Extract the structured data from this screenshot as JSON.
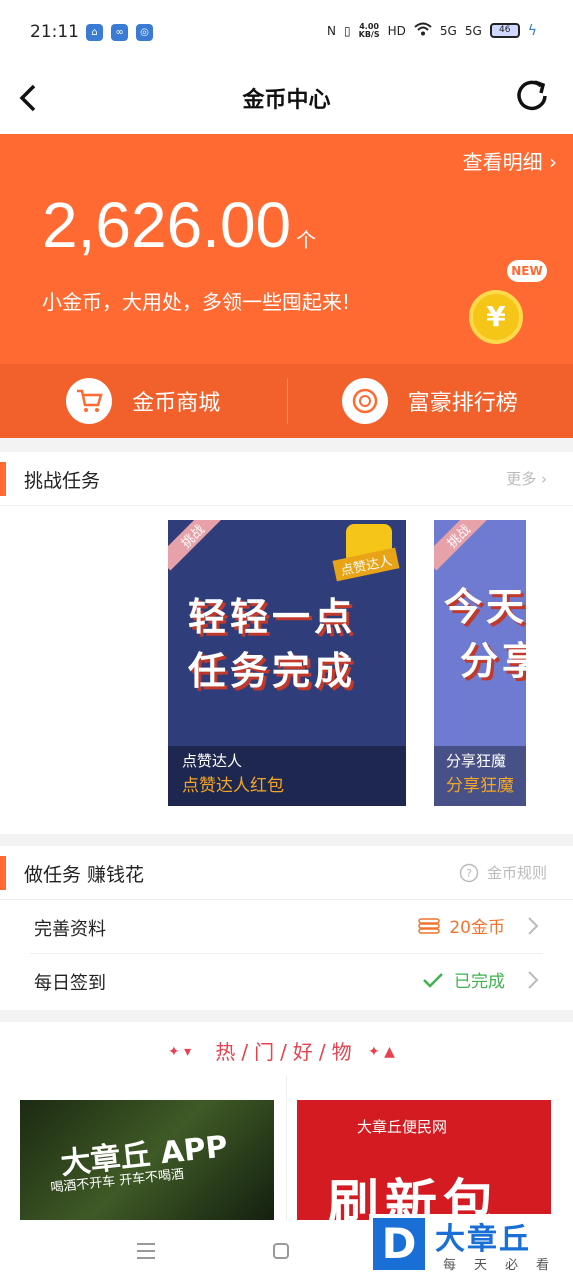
{
  "status_bar": {
    "time": "21:11",
    "speed_value": "4.00",
    "speed_unit": "KB/S",
    "hd": "HD",
    "sig1": "5G",
    "sig2": "5G",
    "battery": "46"
  },
  "nav": {
    "title": "金币中心",
    "back_icon": "back-arrow-icon",
    "refresh_icon": "refresh-icon"
  },
  "hero": {
    "detail_link": "查看明细",
    "coin_amount": "2,626.00",
    "coin_unit": "个",
    "slogan": "小金币，大用处，多领一些囤起来!",
    "new_badge": "NEW",
    "coin_symbol": "¥",
    "accent_color": "#ff6a33"
  },
  "actions": {
    "mall_label": "金币商城",
    "rank_label": "富豪排行榜"
  },
  "challenge": {
    "title": "挑战任务",
    "more": "更多",
    "posters": [
      {
        "tag": "挑战",
        "line1": "轻轻一点",
        "line2": "任务完成",
        "badge": "点赞达人",
        "sub": "点赞达人",
        "name": "点赞达人红包"
      },
      {
        "tag": "挑战",
        "line1": "今天",
        "line2": "分享",
        "sub": "分享狂魔",
        "name": "分享狂魔"
      }
    ]
  },
  "tasks": {
    "title": "做任务 赚钱花",
    "rules": "金币规则",
    "items": [
      {
        "label": "完善资料",
        "status": "20金币"
      },
      {
        "label": "每日签到",
        "status": "已完成"
      }
    ]
  },
  "hot": {
    "title": "热/门/好/物",
    "goods": [
      {
        "big": "大章丘 APP",
        "sub": "喝酒不开车 开车不喝酒"
      },
      {
        "brand": "大章丘便民网",
        "big": "刷新包"
      }
    ]
  },
  "watermark": {
    "letter": "D",
    "title": "大章丘",
    "sub": "每天必看"
  }
}
